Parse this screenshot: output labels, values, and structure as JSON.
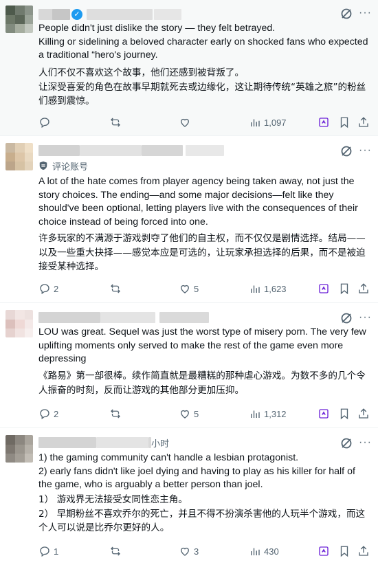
{
  "posts": [
    {
      "text_en": [
        "People didn't just dislike the story — they felt betrayed.",
        "Killing or sidelining a beloved character early on shocked fans who expected a traditional “hero's journey."
      ],
      "text_zh": "人们不仅不喜欢这个故事，他们还感到被背叛了。\n让深受喜爱的角色在故事早期就死去或边缘化，这让期待传统“英雄之旅”的粉丝们感到震惊。",
      "actions": {
        "reply": "",
        "retweet": "",
        "like": "",
        "views": "1,097"
      }
    },
    {
      "note": "评论账号",
      "text_en": [
        "A lot of the hate comes from player agency being taken away, not just the story choices. The ending—and some major decisions—felt like they should've been optional, letting players live with the consequences of their choice instead of being forced into one."
      ],
      "text_zh": "许多玩家的不满源于游戏剥夺了他们的自主权，而不仅仅是剧情选择。结局——以及一些重大抉择——感觉本应是可选的，让玩家承担选择的后果，而不是被迫接受某种选择。",
      "actions": {
        "reply": "2",
        "retweet": "",
        "like": "5",
        "views": "1,623"
      }
    },
    {
      "text_en": [
        "LOU was great. Sequel was just the worst type of misery porn. The very few uplifting moments only served to make the rest of the game even more depressing"
      ],
      "text_zh": "《路易》第一部很棒。续作简直就是最糟糕的那种虐心游戏。为数不多的几个令人振奋的时刻，反而让游戏的其他部分更加压抑。",
      "actions": {
        "reply": "2",
        "retweet": "",
        "like": "5",
        "views": "1,312"
      }
    },
    {
      "time": "小时",
      "text_en": [
        "1) the gaming community can't handle a lesbian protagonist.",
        "2) early fans didn't like joel dying and having to play as his killer for half of the game, who is arguably a better person than joel."
      ],
      "text_zh": "1） 游戏界无法接受女同性恋主角。\n2） 早期粉丝不喜欢乔尔的死亡，并且不得不扮演杀害他的人玩半个游戏，而这个人可以说是比乔尔更好的人。",
      "actions": {
        "reply": "1",
        "retweet": "",
        "like": "3",
        "views": "430"
      }
    }
  ],
  "icons": {
    "reply": "reply-icon",
    "retweet": "retweet-icon",
    "like": "heart-icon",
    "views": "views-icon",
    "grok": "grok-icon",
    "bookmark": "bookmark-icon",
    "share": "share-icon"
  },
  "colors": {
    "accent": "#1d9bf0",
    "muted": "#536471",
    "grok": "#6b21d8"
  }
}
